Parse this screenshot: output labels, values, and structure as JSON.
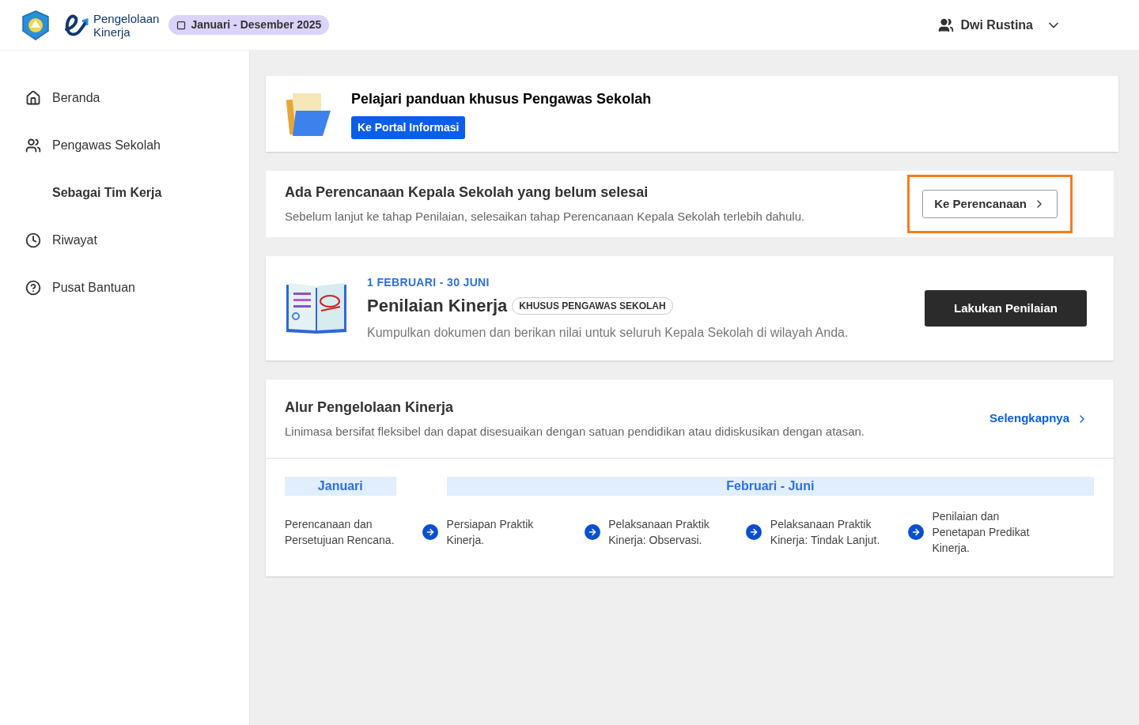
{
  "header": {
    "app_name": [
      "Pengelolaan",
      "Kinerja"
    ],
    "period": "Januari - Desember 2025",
    "user": "Dwi Rustina"
  },
  "sidebar": {
    "items": [
      {
        "label": "Beranda",
        "selected": false
      },
      {
        "label": "Pengawas Sekolah",
        "selected": false,
        "children": [
          {
            "label": "Sebagai Tim Kerja",
            "selected": true
          }
        ]
      },
      {
        "label": "Riwayat",
        "selected": false
      },
      {
        "label": "Pusat Bantuan",
        "selected": false
      }
    ]
  },
  "guide_card": {
    "title": "Pelajari panduan khusus Pengawas Sekolah",
    "button": "Ke Portal Informasi"
  },
  "alert_card": {
    "title": "Ada Perencanaan Kepala Sekolah yang belum selesai",
    "description": "Sebelum lanjut ke tahap Penilaian, selesaikan tahap Perencanaan Kepala Sekolah terlebih dahulu.",
    "button": {
      "label": "Ke Perencanaan",
      "highlighted": true
    }
  },
  "assessment_card": {
    "period": "1 FEBRUARI - 30 JUNI",
    "title": "Penilaian Kinerja",
    "badge": "KHUSUS PENGAWAS SEKOLAH",
    "description": "Kumpulkan dokumen dan berikan nilai untuk seluruh Kepala Sekolah di wilayah Anda.",
    "button": "Lakukan Penilaian"
  },
  "flow_card": {
    "title": "Alur Pengelolaan Kinerja",
    "description": "Linimasa bersifat fleksibel dan dapat disesuaikan dengan satuan pendidikan atau didiskusikan dengan atasan.",
    "link": "Selengkapnya",
    "phases": [
      "Januari",
      "Februari - Juni"
    ],
    "steps": [
      "Perencanaan dan Persetujuan Rencana.",
      "Persiapan Praktik Kinerja.",
      "Pelaksanaan Praktik Kinerja: Observasi.",
      "Pelaksanaan Praktik Kinerja: Tindak Lanjut.",
      "Penilaian dan Penetapan Predikat Kinerja."
    ]
  }
}
